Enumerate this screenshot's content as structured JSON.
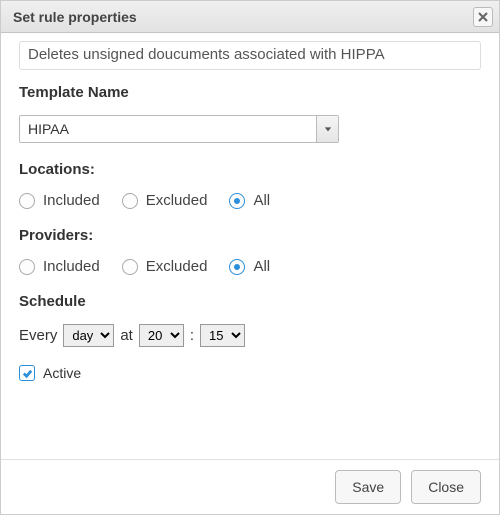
{
  "dialog": {
    "title": "Set rule properties",
    "description": "Deletes unsigned doucuments associated with HIPPA"
  },
  "template": {
    "label": "Template Name",
    "value": "HIPAA"
  },
  "locations": {
    "label": "Locations:",
    "options": {
      "included": "Included",
      "excluded": "Excluded",
      "all": "All"
    },
    "selected": "all"
  },
  "providers": {
    "label": "Providers:",
    "options": {
      "included": "Included",
      "excluded": "Excluded",
      "all": "All"
    },
    "selected": "all"
  },
  "schedule": {
    "label": "Schedule",
    "every_label": "Every",
    "unit": "day",
    "at_label": "at",
    "hour": "20",
    "sep": ":",
    "minute": "15"
  },
  "active": {
    "label": "Active",
    "checked": true
  },
  "footer": {
    "save": "Save",
    "close": "Close"
  }
}
